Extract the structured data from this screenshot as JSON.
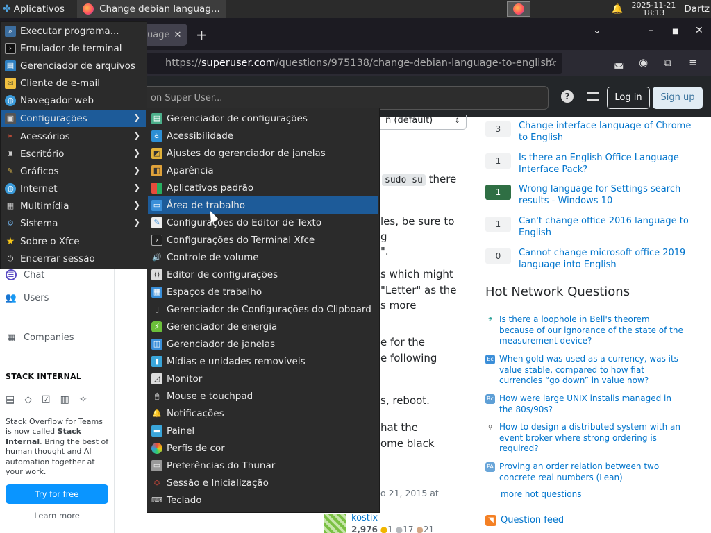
{
  "panel": {
    "apps_label": "Aplicativos",
    "task_title": "Change debian languag...",
    "date": "2025-11-21",
    "time": "18:13",
    "user": "Dartz"
  },
  "browser": {
    "tab_text": "uage",
    "url_prefix": "https://",
    "url_host": "superuser.com",
    "url_path": "/questions/975138/change-debian-language-to-english"
  },
  "header": {
    "search_placeholder": "on Super User...",
    "login": "Log in",
    "signup": "Sign up"
  },
  "left_sidebar": {
    "chat": "Chat",
    "users": "Users",
    "companies": "Companies",
    "stack_heading": "STACK INTERNAL",
    "stack_text_1": "Stack Overflow for Teams is now called ",
    "stack_text_bold": "Stack Internal",
    "stack_text_2": ". Bring the best of human thought and AI automation together at your work.",
    "try_free": "Try for free",
    "learn_more": "Learn more"
  },
  "main": {
    "sort_value": "n (default)",
    "code": "sudo su",
    "frag_there": "there",
    "frag_1": "les, be sure to",
    "frag_2": "g",
    "frag_3": "\".",
    "frag_4": "s which might",
    "frag_5": "\"Letter\" as the",
    "frag_6": "s more",
    "frag_7": "e for the",
    "frag_8": "e following",
    "frag_9": "s, reboot.",
    "frag_10": "hat the",
    "frag_11": "ome black",
    "frag_date": "o 21, 2015 at",
    "user_name": "kostix",
    "user_rep": "2,976",
    "gold": "1",
    "silver": "17",
    "bronze": "21"
  },
  "related": [
    {
      "score": "3",
      "accepted": false,
      "title": "Change interface language of Chrome to English"
    },
    {
      "score": "1",
      "accepted": false,
      "title": "Is there an English Office Language Interface Pack?"
    },
    {
      "score": "1",
      "accepted": true,
      "title": "Wrong language for Settings search results - Windows 10"
    },
    {
      "score": "1",
      "accepted": false,
      "title": "Can't change office 2016 language to English"
    },
    {
      "score": "0",
      "accepted": false,
      "title": "Cannot change microsoft office 2019 language into English"
    }
  ],
  "hnq": {
    "title": "Hot Network Questions",
    "items": [
      {
        "title": "Is there a loophole in Bell's theorem because of our ignorance of the state of the measurement device?"
      },
      {
        "title": "When gold was used as a currency, was its value stable, compared to how fiat currencies “go down” in value now?"
      },
      {
        "title": "How were large UNIX installs managed in the 80s/90s?"
      },
      {
        "title": "How to design a distributed system with an event broker where strong ordering is required?"
      },
      {
        "title": "Proving an order relation between two concrete real numbers (Lean)"
      }
    ],
    "more": "more hot questions",
    "feed": "Question feed"
  },
  "app_menu": [
    {
      "label": "Executar programa...",
      "icon": "run-icon",
      "submenu": false
    },
    {
      "label": "Emulador de terminal",
      "icon": "terminal-icon",
      "submenu": false
    },
    {
      "label": "Gerenciador de arquivos",
      "icon": "file-manager-icon",
      "submenu": false
    },
    {
      "label": "Cliente de e-mail",
      "icon": "mail-icon",
      "submenu": false
    },
    {
      "label": "Navegador web",
      "icon": "web-browser-icon",
      "submenu": false
    },
    {
      "label": "Configurações",
      "icon": "settings-icon",
      "submenu": true
    },
    {
      "label": "Acessórios",
      "icon": "accessories-icon",
      "submenu": true
    },
    {
      "label": "Escritório",
      "icon": "office-icon",
      "submenu": true
    },
    {
      "label": "Gráficos",
      "icon": "graphics-icon",
      "submenu": true
    },
    {
      "label": "Internet",
      "icon": "internet-icon",
      "submenu": true
    },
    {
      "label": "Multimídia",
      "icon": "multimedia-icon",
      "submenu": true
    },
    {
      "label": "Sistema",
      "icon": "system-icon",
      "submenu": true
    },
    {
      "label": "Sobre o Xfce",
      "icon": "star-icon",
      "submenu": false
    },
    {
      "label": "Encerrar sessão",
      "icon": "logout-icon",
      "submenu": false
    }
  ],
  "settings_menu": [
    {
      "label": "Gerenciador de configurações",
      "icon": "settings-manager-icon"
    },
    {
      "label": "Acessibilidade",
      "icon": "accessibility-icon"
    },
    {
      "label": "Ajustes do gerenciador de janelas",
      "icon": "wm-tweaks-icon"
    },
    {
      "label": "Aparência",
      "icon": "appearance-icon"
    },
    {
      "label": "Aplicativos padrão",
      "icon": "default-apps-icon"
    },
    {
      "label": "Área de trabalho",
      "icon": "desktop-icon"
    },
    {
      "label": "Configurações do Editor de Texto",
      "icon": "text-editor-icon"
    },
    {
      "label": "Configurações do Terminal Xfce",
      "icon": "terminal-settings-icon"
    },
    {
      "label": "Controle de volume",
      "icon": "volume-icon"
    },
    {
      "label": "Editor de configurações",
      "icon": "config-editor-icon"
    },
    {
      "label": "Espaços de trabalho",
      "icon": "workspaces-icon"
    },
    {
      "label": "Gerenciador de Configurações do Clipboard",
      "icon": "clipboard-icon"
    },
    {
      "label": "Gerenciador de energia",
      "icon": "power-icon"
    },
    {
      "label": "Gerenciador de janelas",
      "icon": "window-manager-icon"
    },
    {
      "label": "Mídias e unidades removíveis",
      "icon": "removable-media-icon"
    },
    {
      "label": "Monitor",
      "icon": "monitor-icon"
    },
    {
      "label": "Mouse e touchpad",
      "icon": "mouse-icon"
    },
    {
      "label": "Notificações",
      "icon": "notifications-icon"
    },
    {
      "label": "Painel",
      "icon": "panel-icon"
    },
    {
      "label": "Perfis de cor",
      "icon": "color-profiles-icon"
    },
    {
      "label": "Preferências do Thunar",
      "icon": "thunar-icon"
    },
    {
      "label": "Sessão e Inicialização",
      "icon": "session-icon"
    },
    {
      "label": "Teclado",
      "icon": "keyboard-icon"
    }
  ],
  "colors": {
    "menu_bg": "#2b2b2b",
    "menu_highlight": "#1d5b99",
    "link": "#0074cc",
    "accepted": "#2f6f44"
  }
}
